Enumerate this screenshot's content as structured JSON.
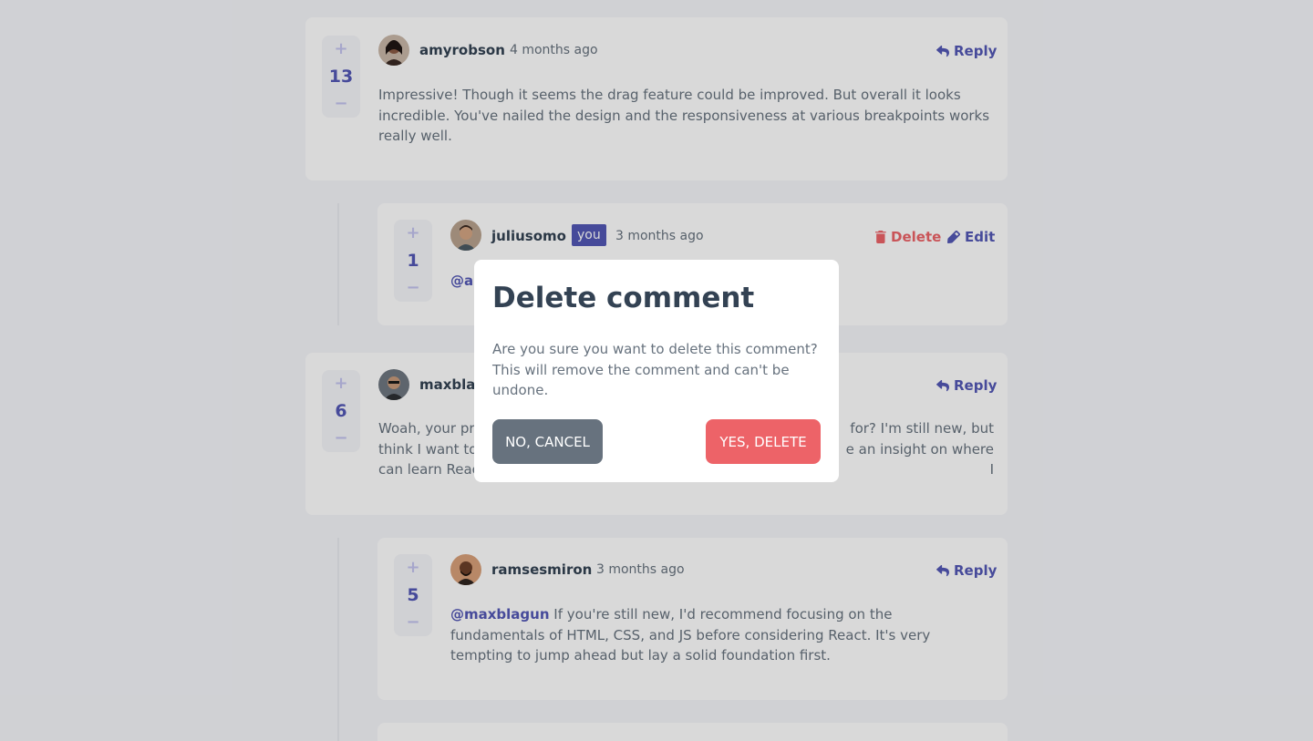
{
  "colors": {
    "primary": "#5357b6",
    "danger": "#ed6368",
    "text_dark": "#334253",
    "text_muted": "#67727e",
    "background": "#f5f6fa"
  },
  "vote_controls": {
    "plus": "+",
    "minus": "−"
  },
  "comments": [
    {
      "username": "amyrobson",
      "timestamp": "4 months ago",
      "score": "13",
      "action": "Reply",
      "content": "Impressive! Though it seems the drag feature could be improved. But overall it looks incredible. You've nailed the design and the responsiveness at various breakpoints works really well."
    },
    {
      "username": "juliusomo",
      "badge": "you",
      "timestamp": "3 months ago",
      "score": "1",
      "delete_label": "Delete",
      "edit_label": "Edit",
      "content_mention": "@ar"
    },
    {
      "username": "maxblag",
      "score": "6",
      "action": "Reply",
      "content_line1_left": "Woah, your pro",
      "content_line1_right": "for? I'm still new, but",
      "content_line2_left": "think I want to",
      "content_line2_right": "e an insight on where I",
      "content_line3_left": "can learn Reac"
    },
    {
      "username": "ramsesmiron",
      "timestamp": "3 months ago",
      "score": "5",
      "action": "Reply",
      "mention": "@maxblagun",
      "content": " If you're still new, I'd recommend focusing on the fundamentals of HTML, CSS, and JS before considering React. It's very tempting to jump ahead but lay a solid foundation first."
    }
  ],
  "modal": {
    "title": "Delete comment",
    "body": "Are you sure you want to delete this comment? This will remove the comment and can't be undone.",
    "cancel_label": "NO, CANCEL",
    "confirm_label": "YES, DELETE"
  },
  "icons": {
    "reply": "reply-arrow-icon",
    "delete": "trash-icon",
    "edit": "pencil-icon"
  }
}
